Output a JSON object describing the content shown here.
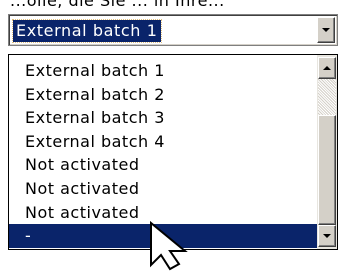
{
  "top_fragment_text": "...olle, die Sie ... in Ihre...",
  "combo": {
    "selected_value": "External batch 1",
    "selection_color": "#0a246a",
    "dropdown_icon": "chevron-down-icon"
  },
  "dropdown": {
    "items": [
      {
        "label": "External batch 1"
      },
      {
        "label": "External batch 2"
      },
      {
        "label": "External batch 3"
      },
      {
        "label": "External batch 4"
      },
      {
        "label": "Not activated"
      },
      {
        "label": "Not activated"
      },
      {
        "label": "Not activated"
      },
      {
        "label": "-"
      }
    ],
    "selected_index": 7,
    "scroll_up_icon": "chevron-up-icon",
    "scroll_down_icon": "chevron-down-icon"
  },
  "cursor_icon": "mouse-pointer-icon"
}
